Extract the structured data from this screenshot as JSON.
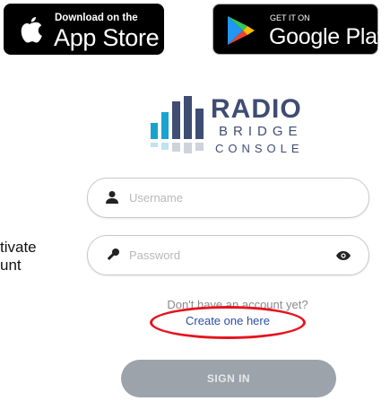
{
  "badges": {
    "app_store": {
      "small": "Download on the",
      "big": "App Store"
    },
    "google_play": {
      "small": "GET IT ON",
      "big": "Google Play"
    }
  },
  "logo": {
    "line1": "RADIO",
    "line2": "BRIDGE",
    "line3": "CONSOLE",
    "color": "#3f4d73"
  },
  "side_text": {
    "line1": "tivate",
    "line2": "unt"
  },
  "login": {
    "username_placeholder": "Username",
    "password_placeholder": "Password",
    "prompt": "Don't have an account yet?",
    "create_link": "Create one here",
    "signin_label": "SIGN IN"
  },
  "colors": {
    "accent_link": "#2a4ea8",
    "annotation_circle": "#e5141f",
    "button_disabled": "#9da3ab"
  }
}
